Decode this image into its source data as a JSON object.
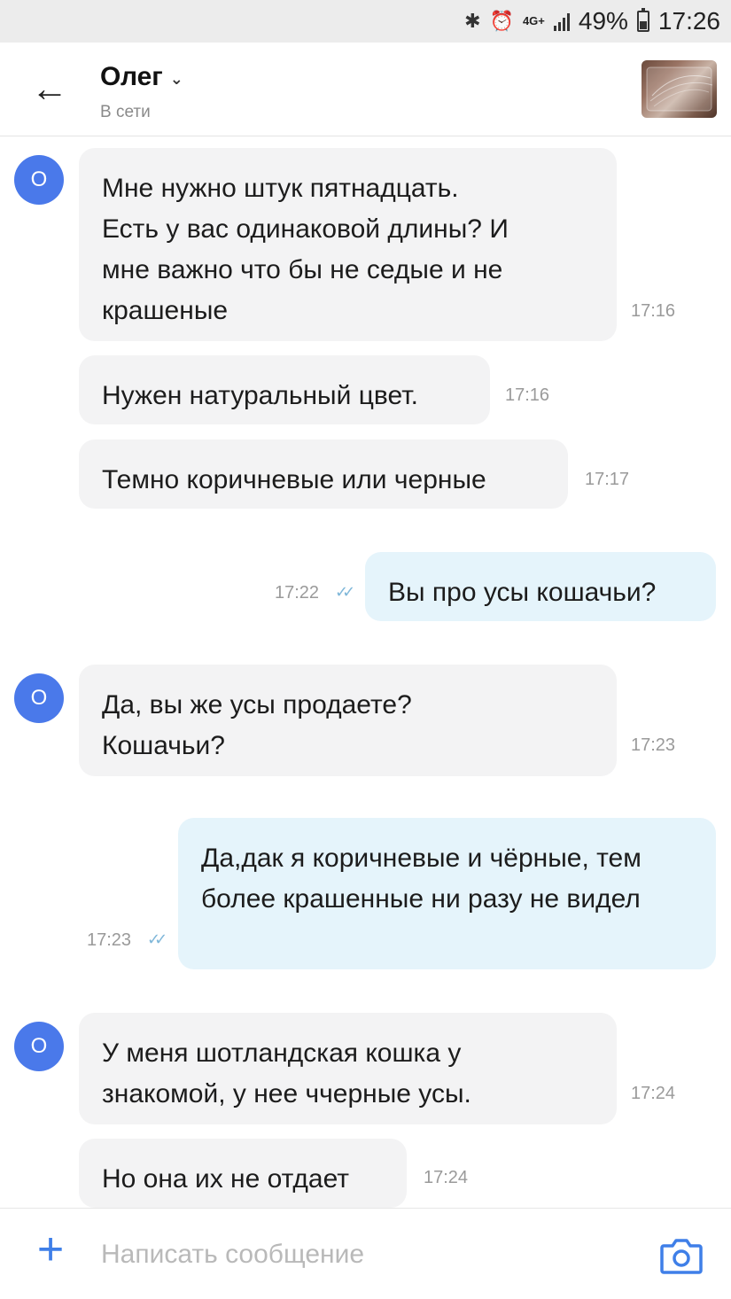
{
  "status_bar": {
    "bluetooth_icon": "bluetooth-icon",
    "alarm_icon": "alarm-icon",
    "network": "4G+",
    "battery": "49%",
    "time": "17:26"
  },
  "header": {
    "back_icon": "arrow-left-icon",
    "contact_name": "Олег",
    "contact_status": "В сети",
    "chevron_icon": "chevron-down-icon"
  },
  "messages": [
    {
      "dir": "in",
      "avatar": "О",
      "text": "Мне нужно штук пятнадцать. Есть у вас одинаковой длины? И мне важно что бы не седые и не крашеные",
      "time": "17:16"
    },
    {
      "dir": "in",
      "text": "Нужен натуральный цвет.",
      "time": "17:16"
    },
    {
      "dir": "in",
      "text": "Темно коричневые или черные",
      "time": "17:17"
    },
    {
      "dir": "out",
      "text": "Вы про усы кошачьи?",
      "time": "17:22",
      "read": true
    },
    {
      "dir": "in",
      "avatar": "О",
      "text": "Да, вы же усы продаете? Кошачьи?",
      "time": "17:23"
    },
    {
      "dir": "out",
      "text": "Да,дак я коричневые и чёрные, тем более крашенные ни разу не видел",
      "time": "17:23",
      "read": true
    },
    {
      "dir": "in",
      "avatar": "О",
      "text": "У меня шотландская кошка у знакомой, у нее ччерные усы.",
      "time": "17:24"
    },
    {
      "dir": "in",
      "text": "Но она их не отдает",
      "time": "17:24"
    }
  ],
  "composer": {
    "placeholder": "Написать сообщение",
    "add_icon": "plus-icon",
    "camera_icon": "camera-icon"
  },
  "colors": {
    "accent": "#3f7fe8",
    "avatar": "#4a79ea",
    "incoming_bubble": "#f3f3f4",
    "outgoing_bubble": "#e5f4fb",
    "read_ticks": "#7fb7d9"
  }
}
